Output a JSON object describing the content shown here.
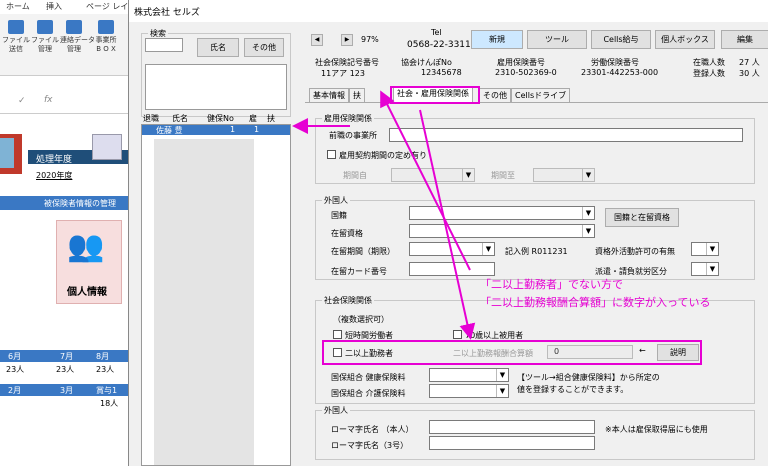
{
  "excel": {
    "tabs": [
      "ホーム",
      "挿入",
      "ページ レイ"
    ],
    "ribbon_buttons": [
      {
        "label": "ファイル\n送信"
      },
      {
        "label": "ファイル\n管理"
      },
      {
        "label": "連絡データ\n管理"
      },
      {
        "label": "事業所\nB O X"
      }
    ],
    "fx": "fx",
    "year_label": "処理年度",
    "year_value": "2020年度",
    "info_label": "被保険者情報の管理",
    "person_label": "個人情報",
    "months_row1": [
      "6月",
      "7月",
      "8月"
    ],
    "counts_row1": [
      "23人",
      "23人",
      "23人"
    ],
    "months_row2": [
      "2月",
      "3月",
      "賞与1"
    ],
    "counts_row2": [
      "",
      "",
      "18人"
    ]
  },
  "window": {
    "title": "株式会社 セルズ",
    "search_label": "検索",
    "name_btn": "氏名",
    "other_btn": "その他",
    "nav_prev": "◀",
    "nav_next": "▶",
    "zoom": "97%",
    "tel_label": "Tel",
    "tel_value": "0568-22-3311",
    "new_btn": "新規",
    "tools_btn": "ツール",
    "cells_btn": "Cells給与",
    "personal_box_btn": "個人ボックス",
    "edit_btn": "編集",
    "codes": [
      {
        "label": "社会保険記号番号",
        "value": "11アア 123"
      },
      {
        "label": "協会けんぽNo",
        "value": "12345678"
      },
      {
        "label": "雇用保険番号",
        "value": "2310-502369-0"
      },
      {
        "label": "労働保険番号",
        "value": "23301-442253-000"
      }
    ],
    "enrolled_label": "在職人数",
    "enrolled_value": "27 人",
    "registered_label": "登録人数",
    "registered_value": "30 人",
    "list_headers": [
      "退職",
      "氏名",
      "健保No",
      "雇",
      "扶"
    ],
    "list_row": {
      "name": "佐藤 豊",
      "kenpo": "1",
      "koyo": "1"
    },
    "tabs": [
      "基本情報",
      "扶",
      "社会・雇用保険関係",
      "その他",
      "Cellsドライブ"
    ],
    "employment": {
      "title": "雇用保険関係",
      "office_label": "前職の事業所",
      "fixed_term_label": "雇用契約期間の定め有り",
      "from_label": "期間自",
      "to_label": "期間至"
    },
    "foreigner": {
      "title": "外国人",
      "nationality": "国籍",
      "status": "在留資格",
      "period": "在留期間（期限）",
      "example": "記入例  R011231",
      "card": "在留カード番号",
      "btn": "国籍と在留資格",
      "outside_activity": "資格外活動許可の有無",
      "dispatch": "派遣・請負就労区分"
    },
    "social": {
      "title": "社会保険関係",
      "multi": "（複数選択可）",
      "short_time": "短時間労働者",
      "over70": "70歳以上被用者",
      "dual": "二以上勤務者",
      "dual_amount_label": "二以上勤務報酬合算額",
      "dual_amount_value": "0",
      "arrow": "←",
      "explain_btn": "説明",
      "health_label": "国保組合 健康保険料",
      "care_label": "国保組合 介護保険料",
      "note1": "【ツール→組合健康保険料】から所定の",
      "note2": "値を登録することができます。"
    },
    "foreigner2": {
      "title": "外国人",
      "romaji1": "ローマ字氏名 （本人）",
      "romaji2": "ローマ字氏名（3号）",
      "note": "※本人は雇保取得届にも使用"
    }
  },
  "annotation": {
    "line1": "「二以上勤務者」でない方で",
    "line2": "「二以上勤務報酬合算額」に数字が入っている",
    "color": "#e600d3"
  }
}
